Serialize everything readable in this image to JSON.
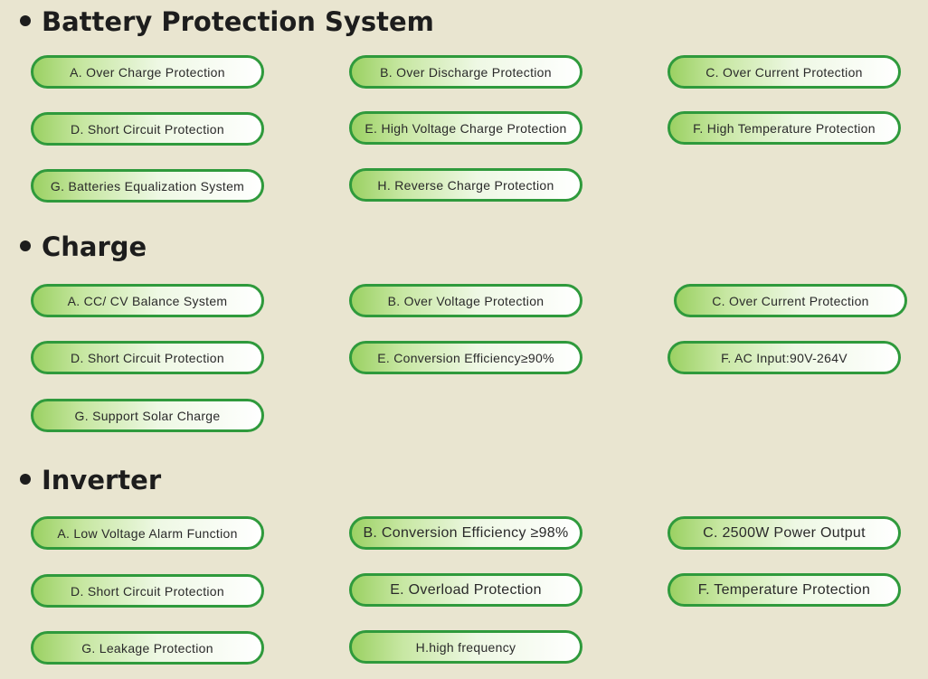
{
  "sections": {
    "battery": {
      "title": "Battery Protection System",
      "items": [
        "A. Over Charge Protection",
        "B. Over Discharge Protection",
        "C. Over Current Protection",
        "D. Short Circuit Protection",
        "E. High Voltage Charge Protection",
        "F. High Temperature Protection",
        "G. Batteries Equalization System",
        "H. Reverse Charge Protection"
      ]
    },
    "charge": {
      "title": "Charge",
      "items": [
        "A. CC/ CV Balance System",
        "B. Over Voltage Protection",
        "C. Over Current Protection",
        "D. Short Circuit Protection",
        "E. Conversion Efficiency≥90%",
        "F. AC Input:90V-264V",
        "G. Support Solar Charge"
      ]
    },
    "inverter": {
      "title": "Inverter",
      "items": [
        "A. Low Voltage Alarm Function",
        "B. Conversion Efficiency ≥98%",
        "C. 2500W Power Output",
        "D. Short Circuit Protection",
        "E. Overload Protection",
        "F. Temperature Protection",
        "G. Leakage Protection",
        "H.high frequency"
      ]
    }
  },
  "colors": {
    "background": "#e9e5d0",
    "pill_border": "#2f9a3c",
    "pill_gradient_start": "#9bd163",
    "title_text": "#1d1d1d"
  }
}
